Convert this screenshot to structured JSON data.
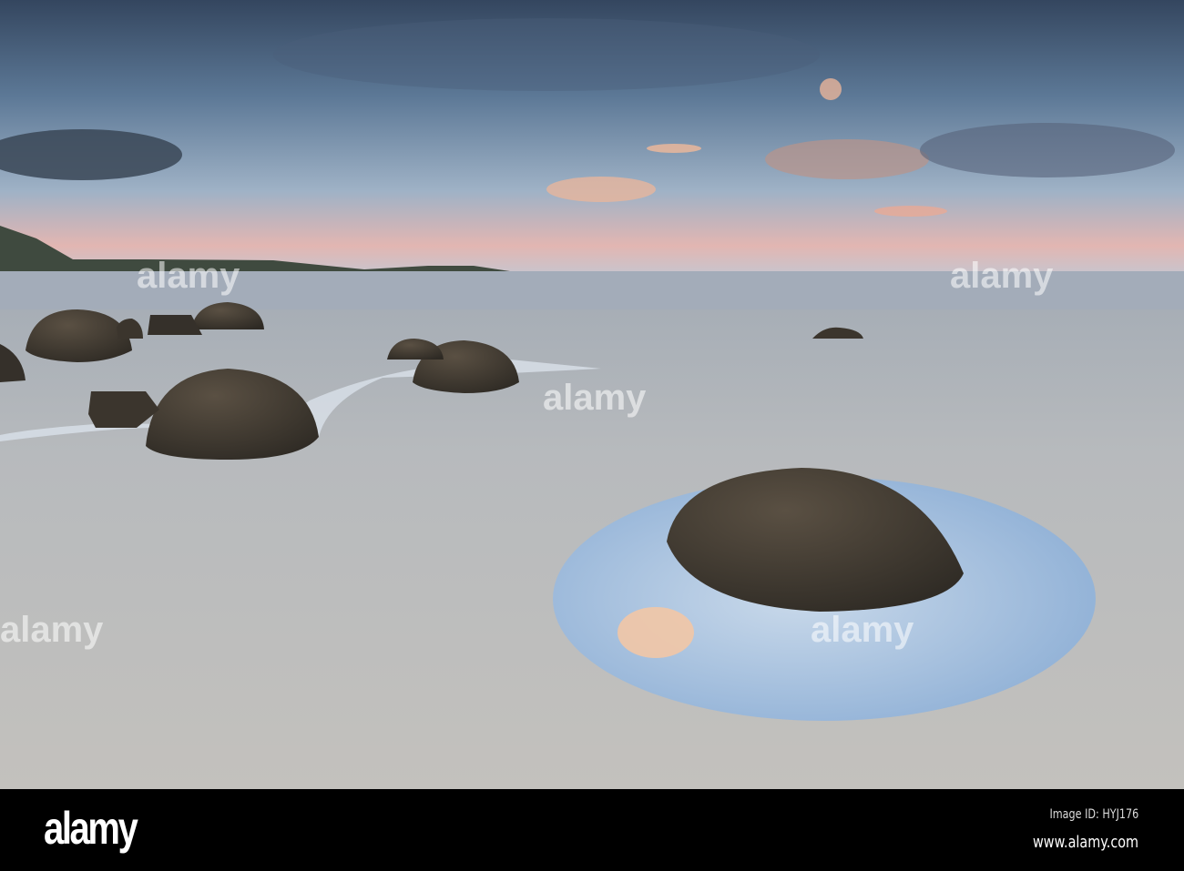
{
  "watermark": {
    "text": "alamy"
  },
  "footer": {
    "logo": "alamy",
    "image_id": "Image ID: HYJ176",
    "url": "www.alamy.com"
  },
  "colors": {
    "sky_top": "#34465f",
    "horizon": "#e9b9b2",
    "sand": "#bcbfc1",
    "boulder": "#3b352d",
    "pool": "#a8c3e0"
  }
}
